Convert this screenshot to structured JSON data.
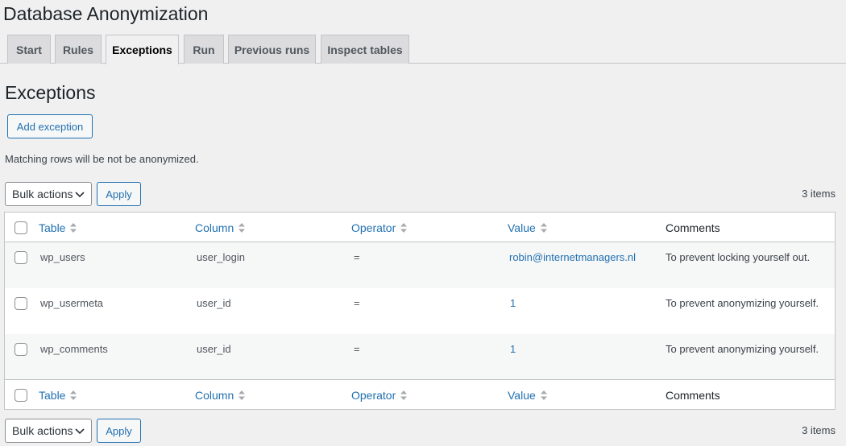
{
  "page": {
    "title": "Database Anonymization"
  },
  "tabs": [
    {
      "label": "Start"
    },
    {
      "label": "Rules"
    },
    {
      "label": "Exceptions",
      "active": true
    },
    {
      "label": "Run"
    },
    {
      "label": "Previous runs"
    },
    {
      "label": "Inspect tables"
    }
  ],
  "section": {
    "title": "Exceptions",
    "add_button": "Add exception",
    "note": "Matching rows will be not be anonymized."
  },
  "bulk_top": {
    "select_value": "Bulk actions",
    "apply_label": "Apply",
    "count": "3 items"
  },
  "bulk_bottom": {
    "select_value": "Bulk actions",
    "apply_label": "Apply",
    "count": "3 items"
  },
  "table": {
    "columns": [
      "Table",
      "Column",
      "Operator",
      "Value",
      "Comments"
    ],
    "rows": [
      {
        "table": "wp_users",
        "column": "user_login",
        "operator": "=",
        "value": "robin@internetmanagers.nl",
        "comment": "To prevent locking yourself out."
      },
      {
        "table": "wp_usermeta",
        "column": "user_id",
        "operator": "=",
        "value": "1",
        "comment": "To prevent anonymizing yourself."
      },
      {
        "table": "wp_comments",
        "column": "user_id",
        "operator": "=",
        "value": "1",
        "comment": "To prevent anonymizing yourself."
      }
    ]
  },
  "colors": {
    "accent": "#2271b1",
    "background": "#f0f0f1",
    "text": "#3c434a"
  },
  "icons": {
    "sort": "sort-arrows-icon",
    "dropdown": "chevron-down-icon"
  }
}
